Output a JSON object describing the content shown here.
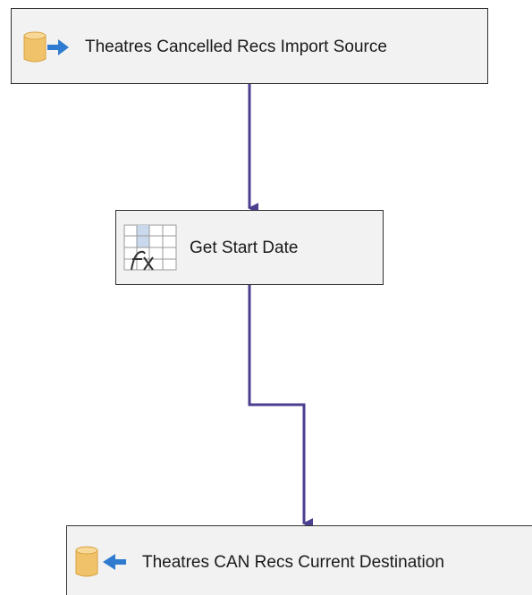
{
  "diagram": {
    "type": "data-flow",
    "nodes": [
      {
        "id": "source",
        "label": "Theatres Cancelled Recs Import Source",
        "icon": "database-source-icon"
      },
      {
        "id": "derived",
        "label": "Get Start Date",
        "icon": "derived-column-fx-icon"
      },
      {
        "id": "dest",
        "label": "Theatres CAN Recs Current Destination",
        "icon": "database-destination-icon"
      }
    ],
    "edges": [
      {
        "from": "source",
        "to": "derived"
      },
      {
        "from": "derived",
        "to": "dest"
      }
    ]
  },
  "colors": {
    "connector": "#4b3f8f",
    "node_fill": "#f2f2f2",
    "node_border": "#333333",
    "cylinder": "#f0c36a",
    "cylinder_shade": "#d9a23f",
    "arrow_blue": "#2e7bcf"
  }
}
